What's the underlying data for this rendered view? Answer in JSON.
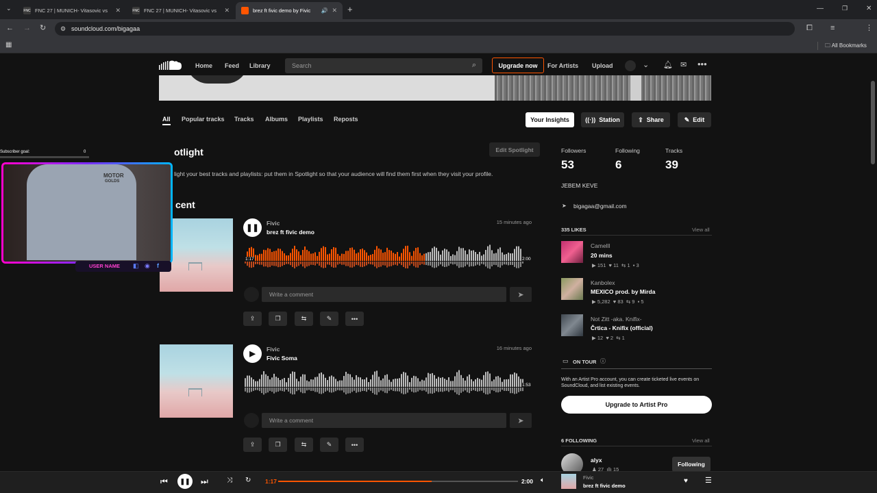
{
  "browser": {
    "tabs": [
      {
        "title": "FNC 27 | MUNICH- Vitasovic vs",
        "favicon": "FNC",
        "active": false
      },
      {
        "title": "FNC 27 | MUNICH- Vitasovic vs",
        "favicon": "FNC",
        "active": false
      },
      {
        "title": "brez ft fivic demo by Fivic",
        "favicon": "soundcloud-icon",
        "active": true
      }
    ],
    "url": "soundcloud.com/bigagaa",
    "bookmarks_label": "All Bookmarks"
  },
  "nav": {
    "home": "Home",
    "feed": "Feed",
    "library": "Library",
    "search_placeholder": "Search",
    "upgrade": "Upgrade now",
    "for_artists": "For Artists",
    "upload": "Upload"
  },
  "profile_tabs": [
    "All",
    "Popular tracks",
    "Tracks",
    "Albums",
    "Playlists",
    "Reposts"
  ],
  "profile_actions": {
    "insights": "Your Insights",
    "station": "Station",
    "share": "Share",
    "edit": "Edit"
  },
  "spotlight": {
    "heading": "otlight",
    "edit": "Edit Spotlight",
    "description": "light your best tracks and playlists: put them in Spotlight so that your audience will find them first when they visit your profile."
  },
  "recent_heading": "cent",
  "tracks": [
    {
      "artist": "Fivic",
      "title": "brez ft fivic demo",
      "ago": "15 minutes ago",
      "elapsed": "1:17",
      "duration": "2:00",
      "progress": 0.64,
      "playing": true,
      "comment_placeholder": "Write a comment"
    },
    {
      "artist": "Fivic",
      "title": "Fivic Soma",
      "ago": "16 minutes ago",
      "elapsed": "",
      "duration": "1:53",
      "progress": 0,
      "playing": false,
      "comment_placeholder": "Write a comment"
    }
  ],
  "stats": {
    "followers_label": "Followers",
    "followers": "53",
    "following_label": "Following",
    "following": "6",
    "tracks_label": "Tracks",
    "tracks": "39"
  },
  "bio": "JEBEM KEVE",
  "email": "bigagaa@gmail.com",
  "likes": {
    "heading": "335 LIKES",
    "view_all": "View all",
    "items": [
      {
        "artist": "Camelll",
        "title": "20 mins",
        "plays": "151",
        "likes": "11",
        "reposts": "1",
        "comments": "3"
      },
      {
        "artist": "Kanbolex",
        "title": "MEXICO prod. by Mirda",
        "plays": "5,282",
        "likes": "83",
        "reposts": "9",
        "comments": "5"
      },
      {
        "artist": "Not Zitt -aka. Knifix-",
        "title": "Črtica - Knifix (official)",
        "plays": "12",
        "likes": "2",
        "reposts": "1",
        "comments": ""
      }
    ]
  },
  "on_tour": {
    "heading": "ON TOUR",
    "text": "With an Artist Pro account, you can create ticketed live events on SoundCloud, and list existing events.",
    "button": "Upgrade to Artist Pro"
  },
  "following_section": {
    "heading": "6 FOLLOWING",
    "view_all": "View all",
    "first": "alyx",
    "first_stats_a": "27",
    "first_stats_b": "15",
    "tooltip": "Following"
  },
  "player": {
    "elapsed": "1:17",
    "duration": "2:00",
    "progress": 0.64,
    "artist": "Fivic",
    "title": "brez ft fivic demo"
  },
  "overlay": {
    "subscriber_goal_label": "Subscriber goal:",
    "subscriber_goal_value": "0",
    "username": "USER NAME",
    "shirt_text_1": "MOTOR",
    "shirt_text_2": "GOLDS"
  },
  "colors": {
    "accent": "#ff5500",
    "background": "#121212"
  }
}
